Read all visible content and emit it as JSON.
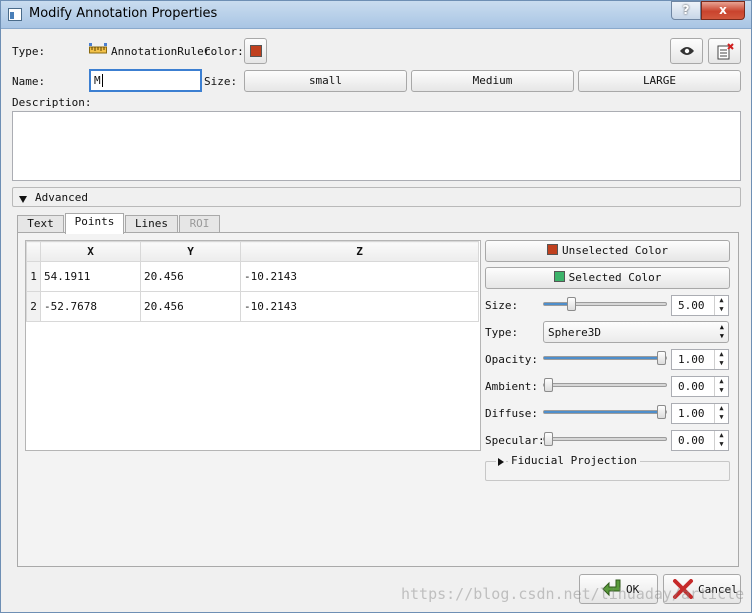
{
  "window": {
    "title": "Modify Annotation Properties",
    "help_glyph": "?",
    "close_glyph": "x"
  },
  "type_row": {
    "label": "Type:",
    "type_value": "AnnotationRuler",
    "color_label": "Color:",
    "color": "#c0401e"
  },
  "name_row": {
    "label": "Name:",
    "value": "M",
    "size_label": "Size:"
  },
  "size_buttons": {
    "small": "small",
    "medium": "Medium",
    "large": "LARGE"
  },
  "description": {
    "label": "Description:",
    "value": ""
  },
  "advanced": {
    "label": "Advanced"
  },
  "tabs": {
    "text": "Text",
    "points": "Points",
    "lines": "Lines",
    "roi": "ROI"
  },
  "points_table": {
    "headers": {
      "x": "X",
      "y": "Y",
      "z": "Z"
    },
    "rows": [
      {
        "num": "1",
        "x": "54.1911",
        "y": "20.456",
        "z": "-10.2143"
      },
      {
        "num": "2",
        "x": "-52.7678",
        "y": "20.456",
        "z": "-10.2143"
      }
    ]
  },
  "props": {
    "unselected_color_label": "Unselected Color",
    "unselected_color": "#c0401e",
    "selected_color_label": "Selected Color",
    "selected_color": "#3cb36a",
    "size": {
      "label": "Size:",
      "value": "5.00",
      "level": 0.2
    },
    "type": {
      "label": "Type:",
      "value": "Sphere3D"
    },
    "opacity": {
      "label": "Opacity:",
      "value": "1.00",
      "level": 1.0
    },
    "ambient": {
      "label": "Ambient:",
      "value": "0.00",
      "level": 0.0
    },
    "diffuse": {
      "label": "Diffuse:",
      "value": "1.00",
      "level": 1.0
    },
    "specular": {
      "label": "Specular:",
      "value": "0.00",
      "level": 0.0
    },
    "fiducial_projection": "Fiducial Projection"
  },
  "footer": {
    "ok": "OK",
    "cancel": "Cancel",
    "watermark": "https://blog.csdn.net/lihuaday/article"
  },
  "colors": {
    "slider_fill": "#4e8ecb"
  }
}
